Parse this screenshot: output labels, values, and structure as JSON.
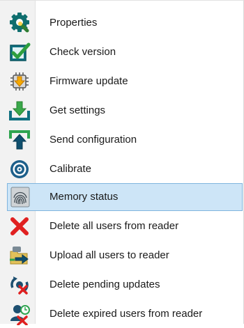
{
  "menu": {
    "items": [
      {
        "label": "Properties",
        "icon": "gear-wrench-icon"
      },
      {
        "label": "Check version",
        "icon": "checkbox-check-icon"
      },
      {
        "label": "Firmware update",
        "icon": "chip-update-icon"
      },
      {
        "label": "Get settings",
        "icon": "download-tray-icon"
      },
      {
        "label": "Send configuration",
        "icon": "upload-tray-icon"
      },
      {
        "label": "Calibrate",
        "icon": "target-icon"
      },
      {
        "label": "Memory status",
        "icon": "fingerprint-icon",
        "selected": true
      },
      {
        "label": "Delete all users from reader",
        "icon": "red-x-icon"
      },
      {
        "label": "Upload all users to reader",
        "icon": "folder-arrow-icon"
      },
      {
        "label": "Delete pending updates",
        "icon": "sync-delete-icon"
      },
      {
        "label": "Delete expired users from reader",
        "icon": "user-clock-delete-icon"
      }
    ]
  },
  "colors": {
    "selection_bg": "#cde5f7",
    "selection_border": "#80b5de",
    "gutter_bg": "#f2f2f2"
  }
}
